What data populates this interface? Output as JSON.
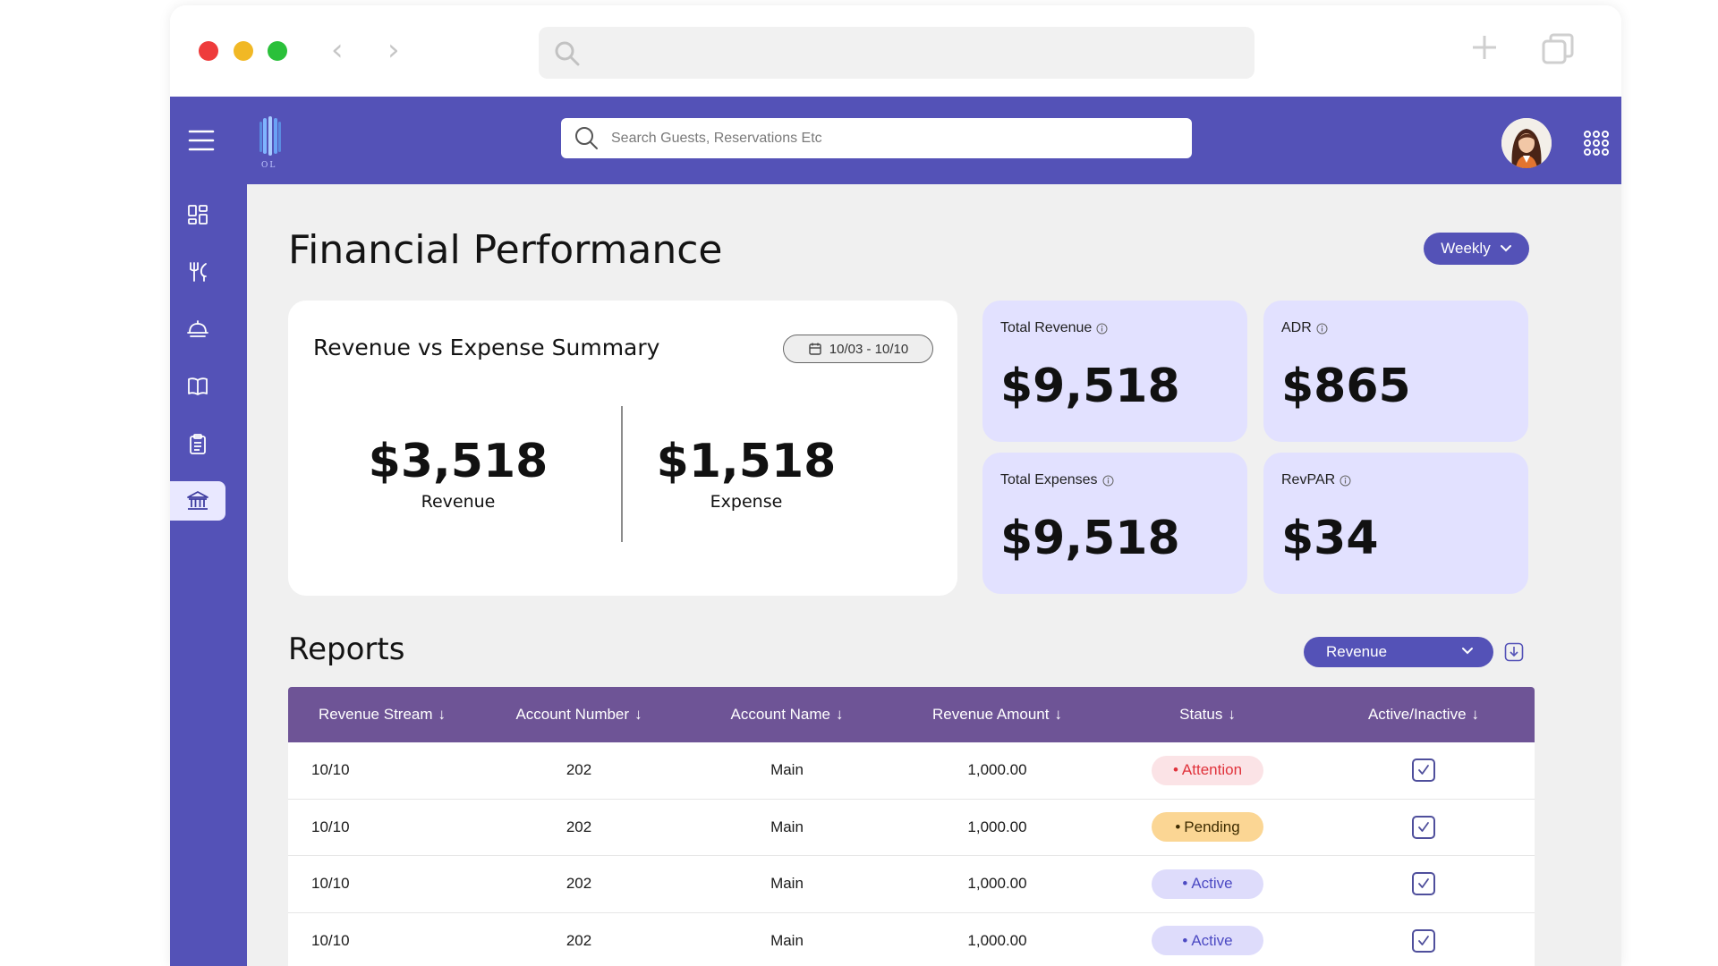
{
  "browser": {
    "back_glyph": "‹",
    "forward_glyph": "›"
  },
  "header": {
    "logo_text": "OL",
    "search_placeholder": "Search Guests, Reservations Etc"
  },
  "sidebar": {
    "items": [
      {
        "icon": "dashboard-icon",
        "active": false
      },
      {
        "icon": "dining-icon",
        "active": false
      },
      {
        "icon": "room-service-icon",
        "active": false
      },
      {
        "icon": "book-icon",
        "active": false
      },
      {
        "icon": "clipboard-icon",
        "active": false
      },
      {
        "icon": "bank-icon",
        "active": true
      }
    ]
  },
  "page": {
    "title": "Financial Performance",
    "period_label": "Weekly"
  },
  "summary": {
    "title": "Revenue vs Expense Summary",
    "date_range": "10/03 - 10/10",
    "revenue_value": "$3,518",
    "revenue_label": "Revenue",
    "expense_value": "$1,518",
    "expense_label": "Expense"
  },
  "kpis": {
    "total_revenue": {
      "label": "Total Revenue",
      "value": "$9,518"
    },
    "adr": {
      "label": "ADR",
      "value": "$865"
    },
    "total_expenses": {
      "label": "Total Expenses",
      "value": "$9,518"
    },
    "revpar": {
      "label": "RevPAR",
      "value": "$34"
    }
  },
  "reports": {
    "title": "Reports",
    "filter_label": "Revenue",
    "columns": [
      "Revenue Stream",
      "Account Number",
      "Account Name",
      "Revenue Amount",
      "Status",
      "Active/Inactive"
    ],
    "rows": [
      {
        "stream": "10/10",
        "account_number": "202",
        "account_name": "Main",
        "amount": "1,000.00",
        "status": "Attention",
        "checked": true
      },
      {
        "stream": "10/10",
        "account_number": "202",
        "account_name": "Main",
        "amount": "1,000.00",
        "status": "Pending",
        "checked": true
      },
      {
        "stream": "10/10",
        "account_number": "202",
        "account_name": "Main",
        "amount": "1,000.00",
        "status": "Active",
        "checked": true
      },
      {
        "stream": "10/10",
        "account_number": "202",
        "account_name": "Main",
        "amount": "1,000.00",
        "status": "Active",
        "checked": true
      }
    ]
  },
  "colors": {
    "brand": "#5452b7",
    "table_header": "#6e5496",
    "kpi_card": "#e2e1ff",
    "attention": "#e0323b",
    "pending": "#fbd694",
    "active": "#4c4ac3"
  }
}
